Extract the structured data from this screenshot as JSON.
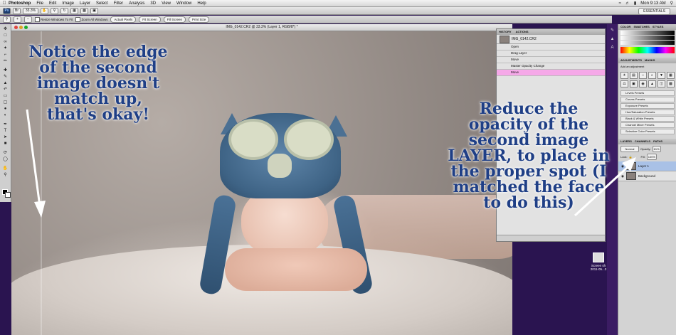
{
  "menubar": {
    "app_name": "Photoshop",
    "menus": [
      "File",
      "Edit",
      "Image",
      "Layer",
      "Select",
      "Filter",
      "Analysis",
      "3D",
      "View",
      "Window",
      "Help"
    ],
    "clock": "Mon 9:13 AM"
  },
  "appbar": {
    "zoom": "33.3%",
    "workspace": "ESSENTIALS"
  },
  "options": {
    "resize_windows": "Resize Windows To Fit",
    "zoom_all_windows": "Zoom All Windows",
    "actual_pixels": "Actual Pixels",
    "fit_screen": "Fit Screen",
    "fill_screen": "Fill Screen",
    "print_size": "Print Size"
  },
  "document": {
    "title": "IMG_0142.CR2 @ 33.3% (Layer 1, RGB/8*) *"
  },
  "annotations": {
    "left": "Notice the edge of the second image doesn't match up, that's okay!",
    "right": "Reduce the opacity of the second image LAYER, to place in the proper spot (I matched the face to do this)"
  },
  "history": {
    "tabs": [
      "HISTORY",
      "ACTIONS"
    ],
    "snapshot": "IMG_0142.CR2",
    "items": [
      "Open",
      "Drag Layer",
      "Move",
      "Master Opacity Change",
      "Move"
    ]
  },
  "panels": {
    "color_tabs": [
      "COLOR",
      "SWATCHES",
      "STYLES"
    ],
    "adjust_tabs": [
      "ADJUSTMENTS",
      "MASKS"
    ],
    "adjust_hint": "Add an adjustment",
    "presets": [
      "Levels Presets",
      "Curves Presets",
      "Exposure Presets",
      "Hue/Saturation Presets",
      "Black & White Presets",
      "Channel Mixer Presets",
      "Selective Color Presets"
    ],
    "layer_tabs": [
      "LAYERS",
      "CHANNELS",
      "PATHS"
    ],
    "blend_mode": "Normal",
    "opacity_label": "Opacity:",
    "opacity_value": "61%",
    "fill_label": "Fill:",
    "fill_value": "100%",
    "lock_label": "Lock:",
    "layers": [
      "Layer 1",
      "Background"
    ]
  },
  "desktop": {
    "file_label": "Screen sh",
    "file_date": "2011-05...3"
  }
}
